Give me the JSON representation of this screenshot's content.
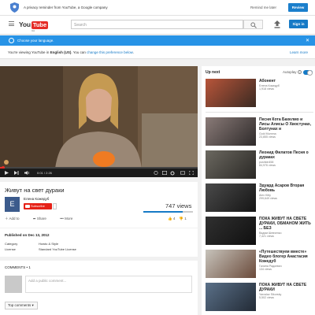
{
  "privacy": {
    "text": "A privacy reminder from YouTube, a Google company",
    "later": "Remind me later",
    "review": "Review"
  },
  "masthead": {
    "logo_you": "You",
    "logo_tube": "Tube",
    "logo_region": "UA",
    "search_placeholder": "Search",
    "sign_in": "Sign in"
  },
  "language": {
    "banner": "Choose your language.",
    "note_prefix": "You're viewing YouTube in ",
    "note_lang": "English (US)",
    "note_mid": ". You can ",
    "note_link": "change this preference below",
    "note_end": ".",
    "learn_more": "Learn more"
  },
  "player": {
    "time": "0:01 / 2:26",
    "progress": 0.01
  },
  "video": {
    "title": "Живут на свет дураки",
    "channel": "Елена Кожедуб",
    "avatar_letter": "E",
    "subscribe": "Subscribe",
    "views": "747 views",
    "add_to": "Add to",
    "share": "Share",
    "more": "More",
    "likes": "4",
    "dislikes": "1",
    "like_ratio": 0.8
  },
  "about": {
    "published": "Published on Dec 13, 2012",
    "category_label": "Category",
    "category_value": "Howto & Style",
    "license_label": "License",
    "license_value": "Standard YouTube License"
  },
  "comments": {
    "header": "COMMENTS • 1",
    "placeholder": "Add a public comment...",
    "sort": "Top comments"
  },
  "sidebar": {
    "up_next": "Up next",
    "autoplay": "Autoplay",
    "autoplay_on": true,
    "items": [
      {
        "title": "Абонент",
        "author": "Елена Кожедуб",
        "views": "1,918 views",
        "duration": "",
        "colors": [
          "#b8553a",
          "#3a2a22"
        ]
      },
      {
        "title": "Песня Кота Бахелмо и Лисы Алисы О Хвостунах, Болтунах и",
        "author": "Gold Mumma",
        "views": "23,855 views",
        "duration": "",
        "colors": [
          "#8a7b78",
          "#2e2a2a"
        ]
      },
      {
        "title": "Леонид Филатов Песня о дураках",
        "author": "pushkin458",
        "views": "84,976 views",
        "duration": "",
        "colors": [
          "#6b6860",
          "#2a2825"
        ]
      },
      {
        "title": "Эдуард Асаров Вторая Любовь",
        "author": "Alex Kitty",
        "views": "299,649 views",
        "duration": "",
        "colors": [
          "#4a4a4a",
          "#151515"
        ]
      },
      {
        "title": "ПОКА ЖИВУТ НА СВЕТЕ ДУРАКИ, ОБМАНОМ ЖИТЬ ... БЕЗ",
        "author": "Вадим Шевченко",
        "views": "7,421 views",
        "duration": "",
        "colors": [
          "#303030",
          "#101010"
        ]
      },
      {
        "title": "«Путешествуем вместе» Видео блогер Анастасия Кожедуб",
        "author": "Галина Радкевич",
        "views": "134 views",
        "duration": "",
        "colors": [
          "#c7c3bb",
          "#6a4a3a"
        ]
      },
      {
        "title": "ПОКА ЖИВУТ НА СВЕТЕ ДУРАКИ",
        "author": "Yaroslav Sikorsky",
        "views": "5,502 views",
        "duration": "",
        "colors": [
          "#5a7088",
          "#222a35"
        ]
      }
    ]
  },
  "colors": {
    "accent": "#167ac6",
    "brand_red": "#e52d27",
    "banner": "#2793e6"
  }
}
